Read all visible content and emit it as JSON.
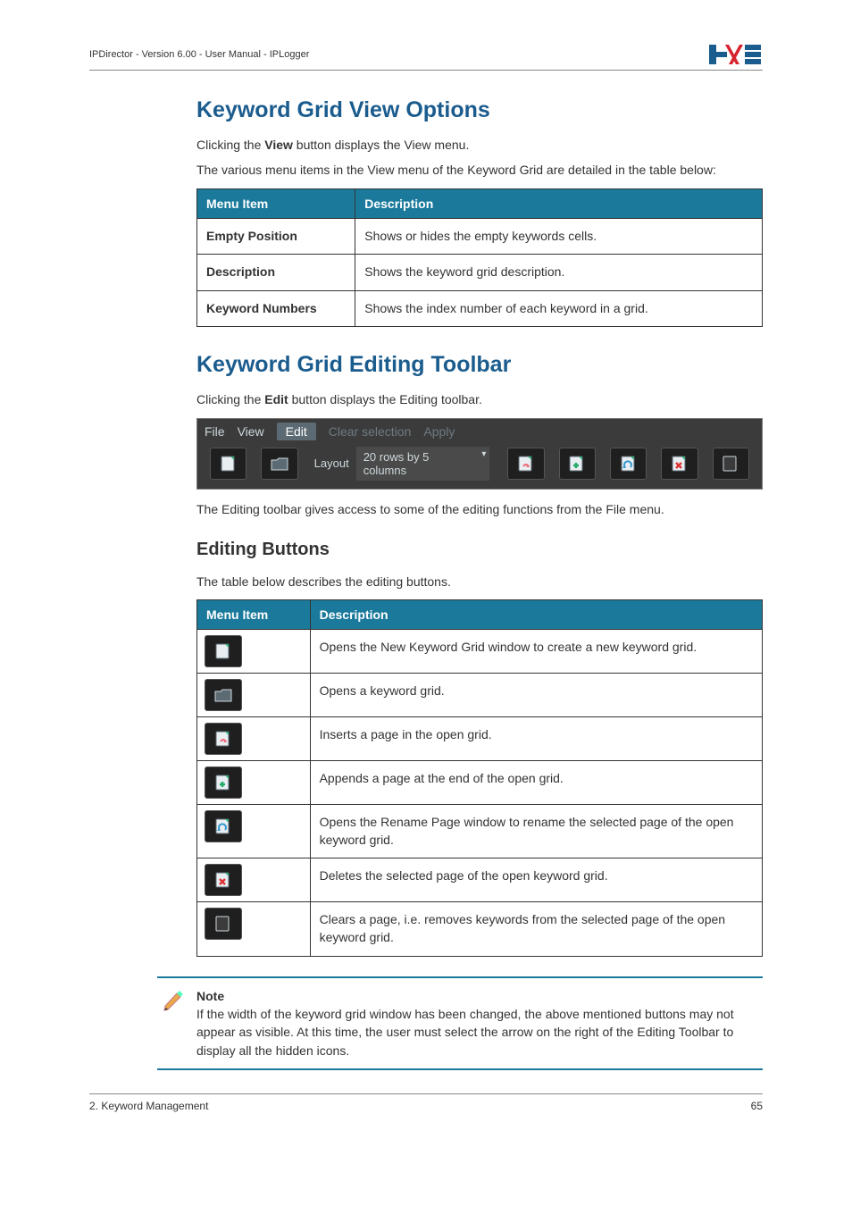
{
  "header": {
    "left": "IPDirector - Version 6.00 - User Manual - IPLogger"
  },
  "section1": {
    "title": "Keyword Grid View Options",
    "p1_a": "Clicking the ",
    "p1_bold": "View",
    "p1_b": " button displays the View menu.",
    "p2": "The various menu items in the View menu of the Keyword Grid are detailed in the table below:",
    "table": {
      "h1": "Menu Item",
      "h2": "Description",
      "rows": [
        {
          "c1": "Empty Position",
          "c2": "Shows or hides the empty keywords cells."
        },
        {
          "c1": "Description",
          "c2": "Shows the keyword grid description."
        },
        {
          "c1": "Keyword Numbers",
          "c2": "Shows the index number of each keyword in a grid."
        }
      ]
    }
  },
  "section2": {
    "title": "Keyword Grid Editing Toolbar",
    "p1_a": "Clicking the ",
    "p1_bold": "Edit",
    "p1_b": " button displays the Editing toolbar.",
    "toolbar": {
      "tabs": {
        "file": "File",
        "view": "View",
        "edit": "Edit",
        "clear": "Clear selection",
        "apply": "Apply"
      },
      "layout_label": "Layout",
      "layout_value": "20 rows by 5 columns"
    },
    "p2": "The Editing toolbar gives access to some of the editing functions from the File menu."
  },
  "section3": {
    "title": "Editing Buttons",
    "p1": "The table below describes the editing buttons.",
    "table": {
      "h1": "Menu Item",
      "h2": "Description",
      "rows": [
        {
          "desc": "Opens the New Keyword Grid window to create a new keyword grid."
        },
        {
          "desc": "Opens a keyword grid."
        },
        {
          "desc": "Inserts a page in the open grid."
        },
        {
          "desc": "Appends a page at the end of the open grid."
        },
        {
          "desc": "Opens the Rename Page window to rename the selected page of the open keyword grid."
        },
        {
          "desc": "Deletes the selected page of the open keyword grid."
        },
        {
          "desc": "Clears a page, i.e. removes keywords from the selected page of the open keyword grid."
        }
      ]
    }
  },
  "note": {
    "label": "Note",
    "text": "If the width of the keyword grid window has been changed, the above mentioned buttons may not appear as visible. At this time, the user must select the arrow on the right of the Editing Toolbar to display all the hidden icons."
  },
  "footer": {
    "left": "2. Keyword Management",
    "right": "65"
  }
}
